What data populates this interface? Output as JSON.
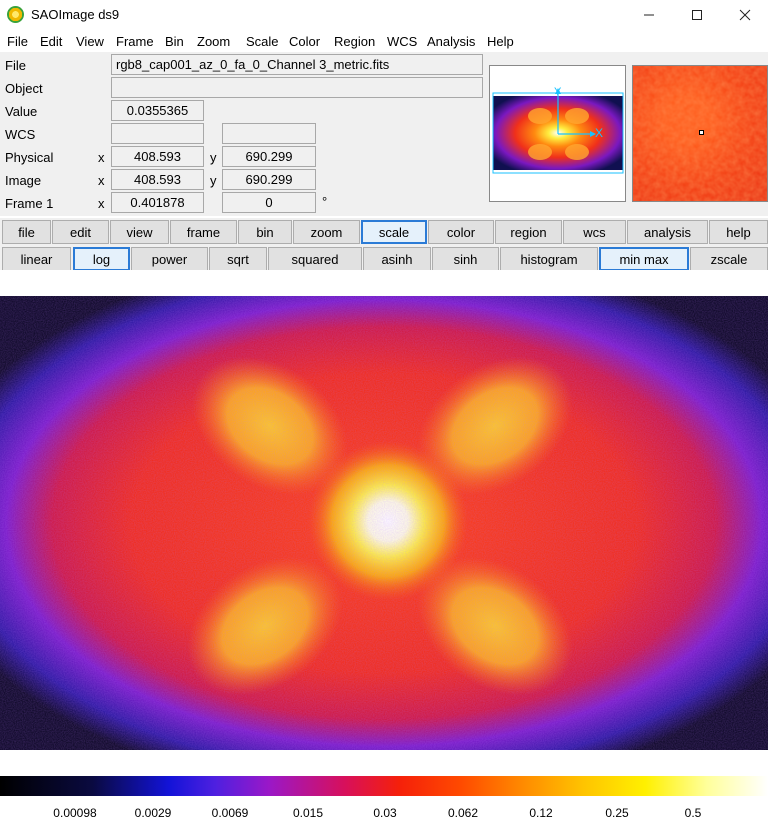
{
  "window": {
    "title": "SAOImage ds9"
  },
  "menu": [
    "File",
    "Edit",
    "View",
    "Frame",
    "Bin",
    "Zoom",
    "Scale",
    "Color",
    "Region",
    "WCS",
    "Analysis",
    "Help"
  ],
  "info": {
    "file_label": "File",
    "file_value": "rgb8_cap001_az_0_fa_0_Channel 3_metric.fits",
    "object_label": "Object",
    "object_value": "",
    "value_label": "Value",
    "value_value": "0.0355365",
    "wcs_label": "WCS",
    "physical_label": "Physical",
    "physical_x": "408.593",
    "physical_y": "690.299",
    "image_label": "Image",
    "image_x": "408.593",
    "image_y": "690.299",
    "frame_label": "Frame 1",
    "frame_zoom": "0.401878",
    "frame_angle": "0",
    "degree_symbol": "°",
    "x_label": "x",
    "y_label": "y"
  },
  "pan_axes": {
    "x": "X",
    "y": "Y"
  },
  "buttonbar_main": [
    "file",
    "edit",
    "view",
    "frame",
    "bin",
    "zoom",
    "scale",
    "color",
    "region",
    "wcs",
    "analysis",
    "help"
  ],
  "buttonbar_main_selected": "scale",
  "buttonbar_scale": [
    "linear",
    "log",
    "power",
    "sqrt",
    "squared",
    "asinh",
    "sinh",
    "histogram",
    "min max",
    "zscale"
  ],
  "buttonbar_scale_selected": [
    "log",
    "min max"
  ],
  "colorbar_ticks": [
    "0.00098",
    "0.0029",
    "0.0069",
    "0.015",
    "0.03",
    "0.062",
    "0.12",
    "0.25",
    "0.5"
  ],
  "colors": {
    "selected_border": "#2b7bd6",
    "panel_bg": "#f0f0f0"
  }
}
